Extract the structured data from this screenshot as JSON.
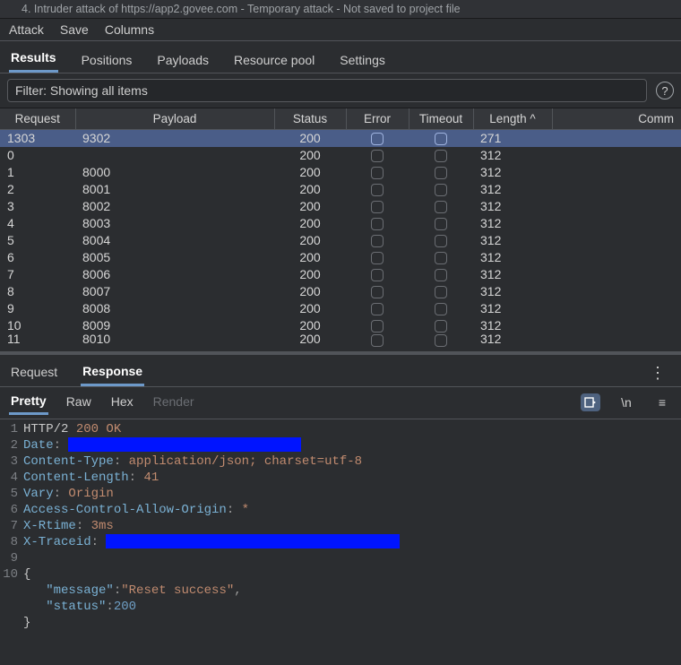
{
  "titlebar": {
    "text": "4. Intruder attack of https://app2.govee.com - Temporary attack - Not saved to project file"
  },
  "menubar": {
    "attack": "Attack",
    "save": "Save",
    "columns": "Columns"
  },
  "main_tabs": {
    "results": "Results",
    "positions": "Positions",
    "payloads": "Payloads",
    "resource_pool": "Resource pool",
    "settings": "Settings"
  },
  "filter": {
    "text": "Filter: Showing all items",
    "help": "?"
  },
  "columns": {
    "request": "Request",
    "payload": "Payload",
    "status": "Status",
    "error": "Error",
    "timeout": "Timeout",
    "length": "Length ^",
    "comment": "Comm"
  },
  "rows": [
    {
      "request": "1303",
      "payload": "9302",
      "status": "200",
      "length": "271",
      "selected": true
    },
    {
      "request": "0",
      "payload": "",
      "status": "200",
      "length": "312"
    },
    {
      "request": "1",
      "payload": "8000",
      "status": "200",
      "length": "312"
    },
    {
      "request": "2",
      "payload": "8001",
      "status": "200",
      "length": "312"
    },
    {
      "request": "3",
      "payload": "8002",
      "status": "200",
      "length": "312"
    },
    {
      "request": "4",
      "payload": "8003",
      "status": "200",
      "length": "312"
    },
    {
      "request": "5",
      "payload": "8004",
      "status": "200",
      "length": "312"
    },
    {
      "request": "6",
      "payload": "8005",
      "status": "200",
      "length": "312"
    },
    {
      "request": "7",
      "payload": "8006",
      "status": "200",
      "length": "312"
    },
    {
      "request": "8",
      "payload": "8007",
      "status": "200",
      "length": "312"
    },
    {
      "request": "9",
      "payload": "8008",
      "status": "200",
      "length": "312"
    },
    {
      "request": "10",
      "payload": "8009",
      "status": "200",
      "length": "312"
    },
    {
      "request": "11",
      "payload": "8010",
      "status": "200",
      "length": "312",
      "cut": true
    }
  ],
  "detail_tabs": {
    "request": "Request",
    "response": "Response"
  },
  "viewmodes": {
    "pretty": "Pretty",
    "raw": "Raw",
    "hex": "Hex",
    "render": "Render",
    "newline": "\\n",
    "menu": "≡"
  },
  "response": {
    "l1_a": "HTTP/2 ",
    "l1_b": "200 OK",
    "l2_a": "Date",
    "l2_b": ": ",
    "l3_a": "Content-Type",
    "l3_b": ": ",
    "l3_c": "application/json; charset=utf-8",
    "l4_a": "Content-Length",
    "l4_b": ": ",
    "l4_c": "41",
    "l5_a": "Vary",
    "l5_b": ": ",
    "l5_c": "Origin",
    "l6_a": "Access-Control-Allow-Origin",
    "l6_b": ": ",
    "l6_c": "*",
    "l7_a": "X-Rtime",
    "l7_b": ": ",
    "l7_c": "3ms",
    "l8_a": "X-Traceid",
    "l8_b": ": ",
    "l10": "{",
    "l11_a": "   \"message\"",
    "l11_b": ":",
    "l11_c": "\"Reset success\"",
    "l11_d": ",",
    "l12_a": "   \"status\"",
    "l12_b": ":",
    "l12_c": "200",
    "l13": "}"
  },
  "gutter": [
    "1",
    "2",
    "3",
    "4",
    "5",
    "6",
    "7",
    "8",
    "9",
    "10"
  ]
}
